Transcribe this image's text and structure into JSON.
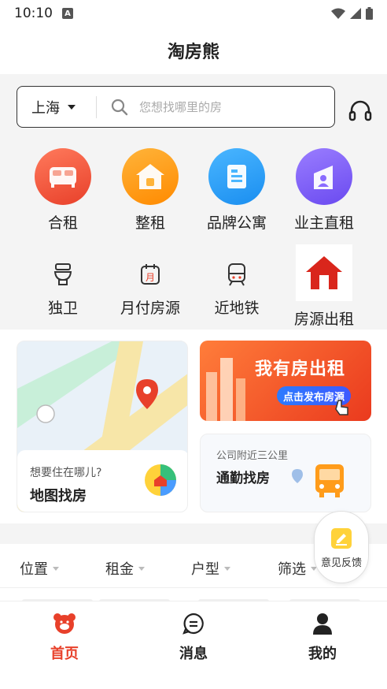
{
  "status_bar": {
    "time": "10:10",
    "notification_icon": "A"
  },
  "header": {
    "title": "淘房熊"
  },
  "search": {
    "city": "上海",
    "placeholder": "您想找哪里的房"
  },
  "categories": [
    {
      "label": "合租",
      "icon": "bed-icon",
      "color": "#f15a45"
    },
    {
      "label": "整租",
      "icon": "house-icon",
      "color": "#ff9c1a"
    },
    {
      "label": "品牌公寓",
      "icon": "building-icon",
      "color": "#2196f3"
    },
    {
      "label": "业主直租",
      "icon": "owner-icon",
      "color": "#7a5af8"
    }
  ],
  "quick_filters": [
    {
      "label": "独卫",
      "icon": "toilet-icon"
    },
    {
      "label": "月付房源",
      "icon": "calendar-icon"
    },
    {
      "label": "近地铁",
      "icon": "subway-icon"
    },
    {
      "label": "房源出租",
      "icon": "red-house-icon"
    }
  ],
  "map_card": {
    "subtitle": "想要住在哪儿?",
    "title": "地图找房"
  },
  "banner": {
    "title": "我有房出租",
    "cta": "点击发布房源"
  },
  "commute_card": {
    "subtitle": "公司附近三公里",
    "title": "通勤找房"
  },
  "filters": [
    "位置",
    "租金",
    "户型",
    "筛选"
  ],
  "feedback": {
    "label": "意见反馈"
  },
  "bottom_nav": [
    {
      "label": "首页",
      "active": true
    },
    {
      "label": "消息",
      "active": false
    },
    {
      "label": "我的",
      "active": false
    }
  ],
  "colors": {
    "accent": "#e8402a",
    "background": "#f4f4f4"
  }
}
